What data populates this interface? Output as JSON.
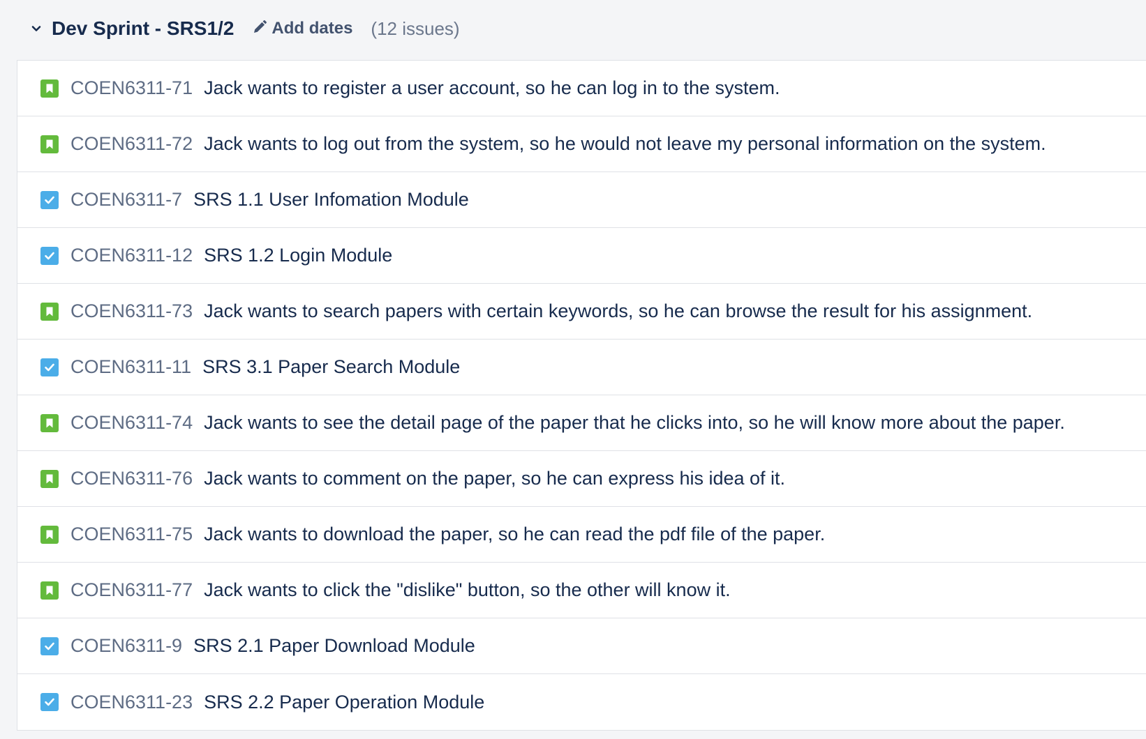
{
  "sprint": {
    "name": "Dev Sprint - SRS1/2",
    "add_dates_label": "Add dates",
    "issue_count": "(12 issues)"
  },
  "colors": {
    "story": "#63ba3c",
    "task": "#4bade8"
  },
  "issues": [
    {
      "type": "story",
      "icon": "story-icon",
      "key": "COEN6311-71",
      "summary": "Jack wants to register a user account, so he can log in to the system."
    },
    {
      "type": "story",
      "icon": "story-icon",
      "key": "COEN6311-72",
      "summary": "Jack wants to log out from the system, so he would not leave my personal information on the system."
    },
    {
      "type": "task",
      "icon": "task-icon",
      "key": "COEN6311-7",
      "summary": "SRS 1.1 User Infomation Module"
    },
    {
      "type": "task",
      "icon": "task-icon",
      "key": "COEN6311-12",
      "summary": "SRS 1.2 Login Module"
    },
    {
      "type": "story",
      "icon": "story-icon",
      "key": "COEN6311-73",
      "summary": "Jack wants to search papers with certain keywords, so he can browse the result for his assignment."
    },
    {
      "type": "task",
      "icon": "task-icon",
      "key": "COEN6311-11",
      "summary": "SRS 3.1 Paper Search Module"
    },
    {
      "type": "story",
      "icon": "story-icon",
      "key": "COEN6311-74",
      "summary": "Jack wants to see the detail page of the paper that he clicks into, so he will know more about the paper."
    },
    {
      "type": "story",
      "icon": "story-icon",
      "key": "COEN6311-76",
      "summary": "Jack wants to comment on the paper, so he can express his idea of it."
    },
    {
      "type": "story",
      "icon": "story-icon",
      "key": "COEN6311-75",
      "summary": "Jack wants to download the paper, so he can read the pdf file of the paper."
    },
    {
      "type": "story",
      "icon": "story-icon",
      "key": "COEN6311-77",
      "summary": "Jack wants to click the \"dislike\" button, so the other will know it."
    },
    {
      "type": "task",
      "icon": "task-icon",
      "key": "COEN6311-9",
      "summary": "SRS 2.1 Paper Download Module"
    },
    {
      "type": "task",
      "icon": "task-icon",
      "key": "COEN6311-23",
      "summary": "SRS 2.2 Paper Operation Module"
    }
  ]
}
